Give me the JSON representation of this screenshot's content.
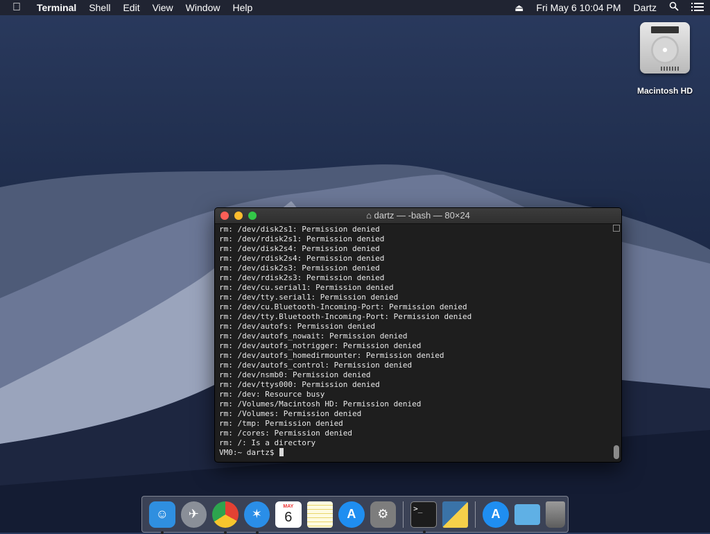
{
  "menubar": {
    "apple": "",
    "app": "Terminal",
    "items": [
      "Shell",
      "Edit",
      "View",
      "Window",
      "Help"
    ],
    "datetime": "Fri May 6  10:04 PM",
    "user": "Dartz"
  },
  "desktop": {
    "icons": [
      {
        "label": "Macintosh HD"
      }
    ]
  },
  "terminal": {
    "title": "dartz — -bash — 80×24",
    "lines": [
      "rm: /dev/disk2s1: Permission denied",
      "rm: /dev/rdisk2s1: Permission denied",
      "rm: /dev/disk2s4: Permission denied",
      "rm: /dev/rdisk2s4: Permission denied",
      "rm: /dev/disk2s3: Permission denied",
      "rm: /dev/rdisk2s3: Permission denied",
      "rm: /dev/cu.serial1: Permission denied",
      "rm: /dev/tty.serial1: Permission denied",
      "rm: /dev/cu.Bluetooth-Incoming-Port: Permission denied",
      "rm: /dev/tty.Bluetooth-Incoming-Port: Permission denied",
      "rm: /dev/autofs: Permission denied",
      "rm: /dev/autofs_nowait: Permission denied",
      "rm: /dev/autofs_notrigger: Permission denied",
      "rm: /dev/autofs_homedirmounter: Permission denied",
      "rm: /dev/autofs_control: Permission denied",
      "rm: /dev/nsmb0: Permission denied",
      "rm: /dev/ttys000: Permission denied",
      "rm: /dev: Resource busy",
      "rm: /Volumes/Macintosh HD: Permission denied",
      "rm: /Volumes: Permission denied",
      "rm: /tmp: Permission denied",
      "rm: /cores: Permission denied",
      "rm: /: Is a directory"
    ],
    "prompt": "VM0:~ dartz$ "
  },
  "dock": {
    "apps": [
      {
        "name": "Finder",
        "icon": "finder-icon",
        "running": true,
        "color": "#2f8fe0"
      },
      {
        "name": "Launchpad",
        "icon": "rocket-icon",
        "running": false,
        "color": "#8a8f98"
      },
      {
        "name": "Chrome",
        "icon": "chrome-icon",
        "running": true,
        "color": "#e34133"
      },
      {
        "name": "Safari",
        "icon": "compass-icon",
        "running": true,
        "color": "#2a8ee8"
      },
      {
        "name": "Calendar",
        "icon": "calendar-icon",
        "running": false,
        "color": "#ffffff",
        "month": "MAY",
        "day": "6"
      },
      {
        "name": "Notes",
        "icon": "notes-icon",
        "running": false,
        "color": "#f6e27a"
      },
      {
        "name": "App Store",
        "icon": "appstore-icon",
        "running": false,
        "color": "#1f8ef1"
      },
      {
        "name": "System Preferences",
        "icon": "gear-icon",
        "running": false,
        "color": "#7d7d7d"
      },
      {
        "name": "Terminal",
        "icon": "terminal-icon",
        "running": true,
        "color": "#1c1c1c"
      },
      {
        "name": "Python Launcher",
        "icon": "python-icon",
        "running": false,
        "color": "#e9e9e9"
      },
      {
        "name": "Downloads",
        "icon": "appstore-folder-icon",
        "running": false,
        "color": "#1f8ef1"
      },
      {
        "name": "Documents",
        "icon": "folder-icon",
        "running": false,
        "color": "#5fb0e5"
      },
      {
        "name": "Trash",
        "icon": "trash-icon",
        "running": false,
        "color": "#6e6e6e"
      }
    ]
  }
}
